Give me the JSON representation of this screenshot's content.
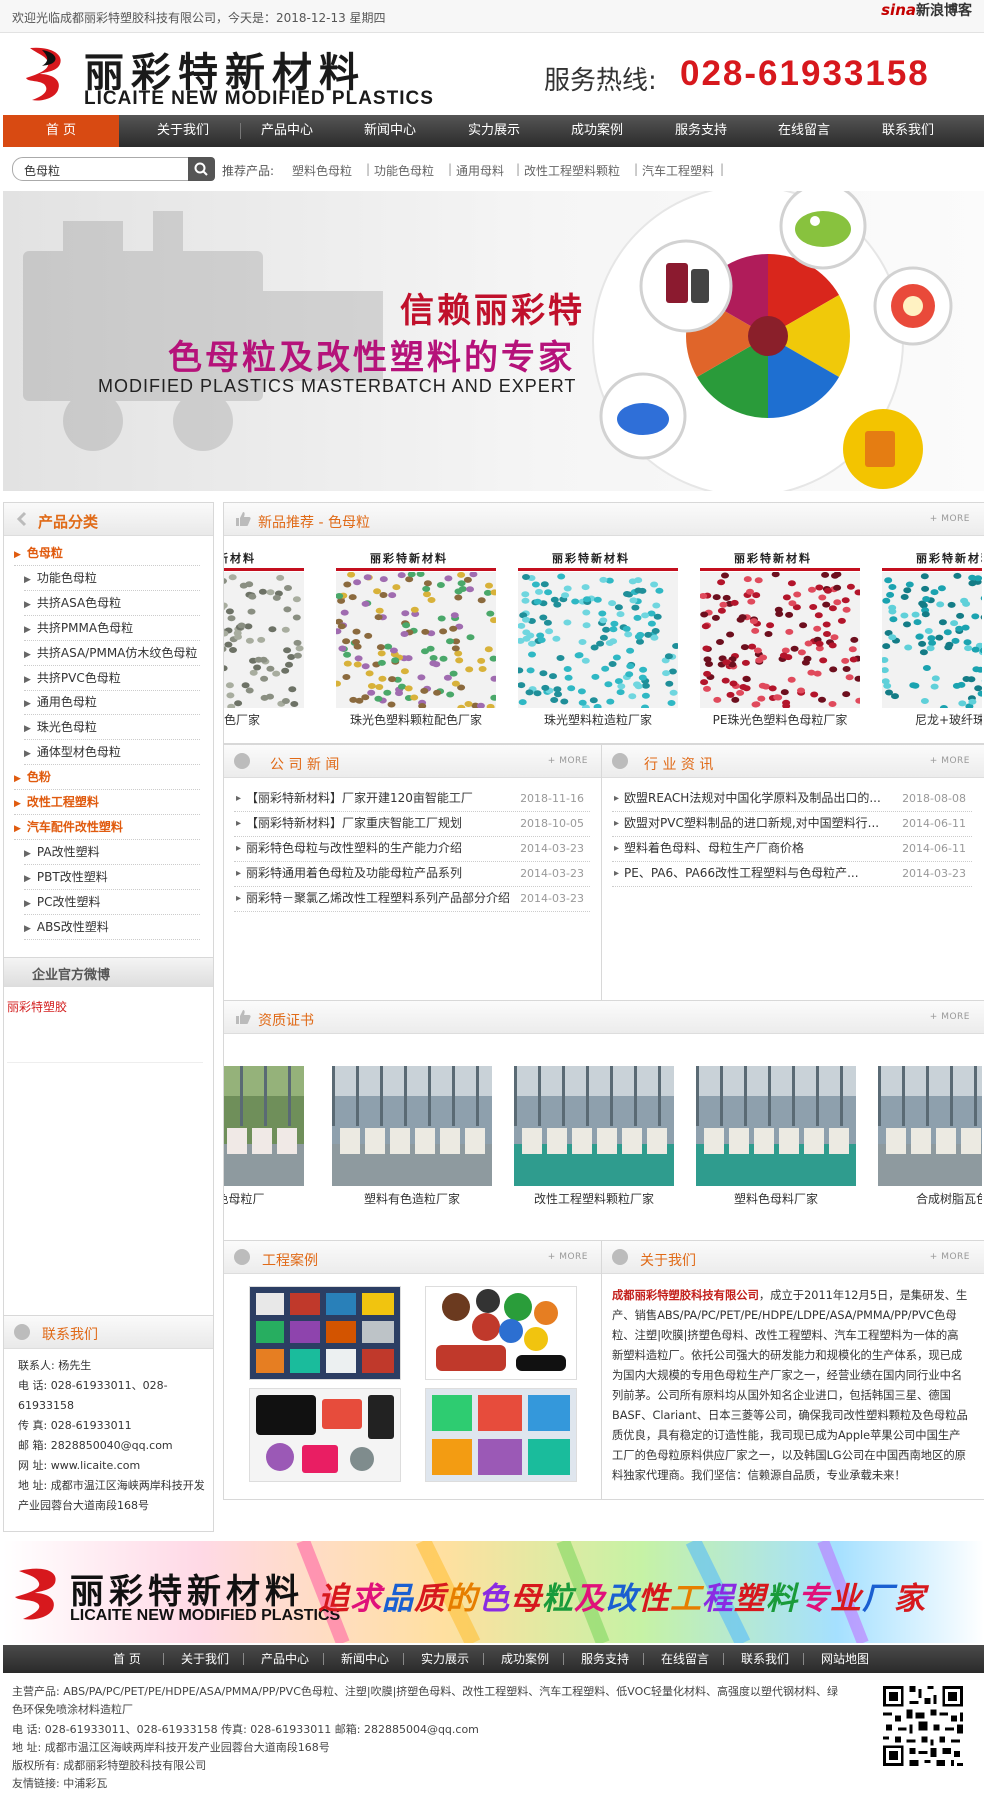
{
  "topbar": {
    "welcome": "欢迎光临成都丽彩特塑胶科技有限公司，今天是：2018-12-13 星期四",
    "sina_brand": "sina",
    "sina_text": "新浪博客"
  },
  "header": {
    "logo_cn": "丽彩特新材料",
    "logo_en": "LICAITE NEW MODIFIED PLASTICS",
    "hotline_label": "服务热线:",
    "hotline_number": "028-61933158"
  },
  "nav": {
    "items": [
      "首 页",
      "关于我们",
      "产品中心",
      "新闻中心",
      "实力展示",
      "成功案例",
      "服务支持",
      "在线留言",
      "联系我们"
    ]
  },
  "search": {
    "value": "色母粒",
    "recommend_label": "推荐产品:",
    "links": [
      "塑料色母粒",
      "功能色母粒",
      "通用母料",
      "改性工程塑料颗粒",
      "汽车工程塑料"
    ]
  },
  "banner": {
    "line1": "信赖丽彩特",
    "line2": "色母粒及改性塑料的专家",
    "line3": "MODIFIED PLASTICS MASTERBATCH AND EXPERT"
  },
  "sidebar": {
    "category_title": "产品分类",
    "categories": [
      {
        "label": "色母粒",
        "level": "main"
      },
      {
        "label": "功能色母粒",
        "level": "sub"
      },
      {
        "label": "共挤ASA色母粒",
        "level": "sub"
      },
      {
        "label": "共挤PMMA色母粒",
        "level": "sub"
      },
      {
        "label": "共挤ASA/PMMA仿木纹色母粒",
        "level": "sub"
      },
      {
        "label": "共挤PVC色母粒",
        "level": "sub"
      },
      {
        "label": "通用色母粒",
        "level": "sub"
      },
      {
        "label": "珠光色母粒",
        "level": "sub"
      },
      {
        "label": "通体型材色母粒",
        "level": "sub"
      },
      {
        "label": "色粉",
        "level": "main"
      },
      {
        "label": "改性工程塑料",
        "level": "main"
      },
      {
        "label": "汽车配件改性塑料",
        "level": "main"
      },
      {
        "label": "PA改性塑料",
        "level": "sub"
      },
      {
        "label": "PBT改性塑料",
        "level": "sub"
      },
      {
        "label": "PC改性塑料",
        "level": "sub"
      },
      {
        "label": "ABS改性塑料",
        "level": "sub"
      }
    ],
    "weibo_title": "企业官方微博",
    "weibo_link": "丽彩特塑胶",
    "contact_title": "联系我们",
    "contact_lines": [
      "联系人: 杨先生",
      "电  话: 028-61933011、028-61933158",
      "传  真: 028-61933011",
      "邮  箱: 2828850040@qq.com",
      "网  址: www.licaite.com",
      "地  址: 成都市温江区海峡两岸科技开发产业园蓉台大道南段168号"
    ]
  },
  "products": {
    "title": "新品推荐 - 色母粒",
    "more": "+ MORE",
    "items": [
      {
        "caption": "原料配色厂家"
      },
      {
        "caption": "珠光色塑料颗粒配色厂家"
      },
      {
        "caption": "珠光塑料粒造粒厂家"
      },
      {
        "caption": "PE珠光色塑料色母粒厂家"
      },
      {
        "caption": "尼龙+玻纤珠光色"
      }
    ],
    "card_brand": "丽彩特新材料"
  },
  "company_news": {
    "title": "公 司 新 闻",
    "more": "+ MORE",
    "items": [
      {
        "title": "【丽彩特新材料】厂家开建120亩智能工厂",
        "date": "2018-11-16"
      },
      {
        "title": "【丽彩特新材料】厂家重庆智能工厂规划",
        "date": "2018-10-05"
      },
      {
        "title": "丽彩特色母粒与改性塑料的生产能力介绍",
        "date": "2014-03-23"
      },
      {
        "title": "丽彩特通用着色母粒及功能母粒产品系列",
        "date": "2014-03-23"
      },
      {
        "title": "丽彩特－聚氯乙烯改性工程塑料系列产品部分介绍",
        "date": "2014-03-23"
      }
    ]
  },
  "industry_news": {
    "title": "行 业 资 讯",
    "more": "+ MORE",
    "items": [
      {
        "title": "欧盟REACH法规对中国化学原料及制品出口的...",
        "date": "2018-08-08"
      },
      {
        "title": "欧盟对PVC塑料制品的进口新规,对中国塑料行...",
        "date": "2014-06-11"
      },
      {
        "title": "塑料着色母料、母粒生产厂商价格",
        "date": "2014-06-11"
      },
      {
        "title": "PE、PA6、PA66改性工程塑料与色母粒产...",
        "date": "2014-03-23"
      }
    ]
  },
  "certificates": {
    "title": "资质证书",
    "more": "+ MORE",
    "items": [
      {
        "caption": "瓦asa色母粒厂"
      },
      {
        "caption": "塑料有色造粒厂家"
      },
      {
        "caption": "改性工程塑料颗粒厂家"
      },
      {
        "caption": "塑料色母料厂家"
      },
      {
        "caption": "合成树脂瓦色母"
      }
    ]
  },
  "cases": {
    "title": "工程案例",
    "more": "+ MORE"
  },
  "about": {
    "title": "关于我们",
    "more": "+ MORE",
    "company": "成都丽彩特塑胶科技有限公司",
    "text": "，成立于2011年12月5日，是集研发、生产、销售ABS/PA/PC/PET/PE/HDPE/LDPE/ASA/PMMA/PP/PVC色母粒、注塑|吹膜|挤塑色母料、改性工程塑料、汽车工程塑料为一体的高新塑料造粒厂。依托公司强大的研发能力和规模化的生产体系，现已成为国内大规模的专用色母粒生产厂家之一，经营业绩在国内同行业中名列前茅。公司所有原料均从国外知名企业进口，包括韩国三星、德国BASF、Clariant、日本三菱等公司，确保我司改性塑料颗粒及色母粒品质优良，具有稳定的订造性能，我司现已成为Apple苹果公司中国生产工厂的色母粒原料供应厂家之一，以及韩国LG公司在中国西南地区的原料独家代理商。我们坚信：信赖源自品质，专业承载未来！"
  },
  "footer": {
    "logo_cn": "丽彩特新材料",
    "logo_en": "LICAITE NEW MODIFIED PLASTICS",
    "slogan": "追求品质的色母粒及改性工程塑料专业厂家",
    "nav": [
      "首 页",
      "关于我们",
      "产品中心",
      "新闻中心",
      "实力展示",
      "成功案例",
      "服务支持",
      "在线留言",
      "联系我们",
      "网站地图"
    ],
    "lines": [
      "主营产品: ABS/PA/PC/PET/PE/HDPE/ASA/PMMA/PP/PVC色母粒、注塑|吹膜|挤塑色母料、改性工程塑料、汽车工程塑料、低VOC轻量化材料、高强度以塑代钢材料、绿",
      "色环保免喷涂材料造粒厂",
      "电      话: 028-61933011、028-61933158      传真: 028-61933011      邮箱: 282885004@qq.com",
      "地      址: 成都市温江区海峡两岸科技开发产业园蓉台大道南段168号",
      "版权所有: 成都丽彩特塑胶科技有限公司",
      "友情链接: 中浦彩瓦"
    ]
  },
  "colors": {
    "accent": "#e06a17",
    "nav_active": "#d84a12",
    "hotline": "#d7181d",
    "banner_red": "#c0102b",
    "banner_magenta": "#b5127a"
  }
}
